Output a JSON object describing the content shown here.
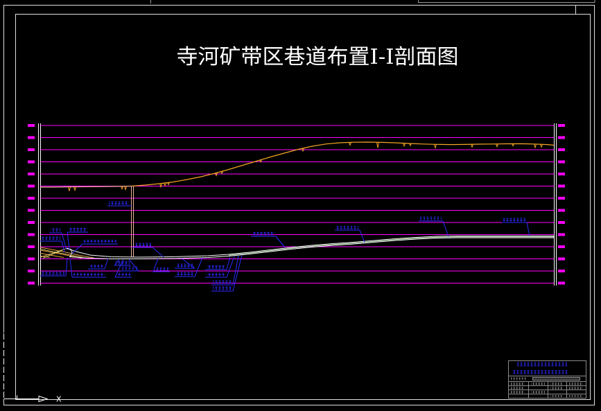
{
  "drawing": {
    "title": "寺河矿带区巷道布置I-I剖面图"
  },
  "ucs_icon": {
    "icon": "ucs-axis-icon",
    "x_axis_label": "X"
  },
  "colors": {
    "background": "#000000",
    "border": "#e0e0e0",
    "title_text": "#ffffff",
    "elevation_grid": "#ff00ff",
    "ground_surface": "#f5a623",
    "roadway": "#ffffff",
    "annotation": "#2b2bff",
    "title_block": "#8c8c8c"
  }
}
